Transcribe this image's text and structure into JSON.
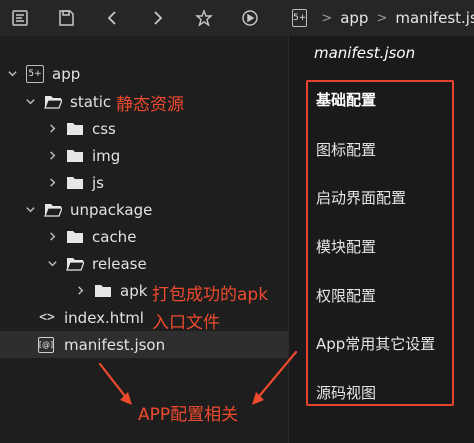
{
  "breadcrumb": {
    "logo": "5+",
    "items": [
      "app",
      "manifest.json"
    ]
  },
  "tree": {
    "rows": [
      {
        "label": "app",
        "icon": "logo"
      },
      {
        "label": "static",
        "icon": "folder"
      },
      {
        "label": "css",
        "icon": "folder"
      },
      {
        "label": "img",
        "icon": "folder"
      },
      {
        "label": "js",
        "icon": "folder"
      },
      {
        "label": "unpackage",
        "icon": "folder"
      },
      {
        "label": "cache",
        "icon": "folder"
      },
      {
        "label": "release",
        "icon": "folder"
      },
      {
        "label": "apk",
        "icon": "folder"
      },
      {
        "label": "index.html",
        "icon": "code"
      },
      {
        "label": "manifest.json",
        "icon": "manifest"
      }
    ],
    "logo_glyph": "5+",
    "code_glyph": "<>",
    "manifest_glyph": "[@]"
  },
  "editor": {
    "title": "manifest.json",
    "items": [
      "基础配置",
      "图标配置",
      "启动界面配置",
      "模块配置",
      "权限配置",
      "App常用其它设置",
      "源码视图"
    ]
  },
  "annotations": {
    "static_note": "静态资源",
    "apk_note_line1": "打包成功的apk",
    "apk_note_line2": "入口文件",
    "app_config_note": "APP配置相关"
  },
  "colors": {
    "accent": "#e8432d",
    "background": "#1e1e1e"
  }
}
